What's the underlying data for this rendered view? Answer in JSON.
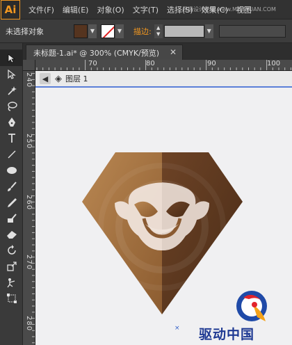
{
  "app": {
    "logo": "Ai"
  },
  "menu": {
    "items": [
      "文件(F)",
      "编辑(E)",
      "对象(O)",
      "文字(T)",
      "选择(S)",
      "效果(C)",
      "视图"
    ]
  },
  "control_bar": {
    "selection_label": "未选择对象",
    "fill_color": "#55341f",
    "stroke_label": "描边:"
  },
  "document": {
    "tab_title": "未标题-1.ai* @ 300% (CMYK/预览)",
    "close": "✕"
  },
  "ruler": {
    "horizontal": [
      "70",
      "80",
      "90",
      "100"
    ],
    "vertical": [
      "240",
      "250",
      "260",
      "270",
      "280"
    ]
  },
  "isolation": {
    "back_icon": "left-arrow-icon",
    "label": "图层 1"
  },
  "tools": [
    "selection-tool-icon",
    "direct-selection-tool-icon",
    "magic-wand-icon",
    "lasso-icon",
    "pen-tool-icon",
    "type-tool-icon",
    "line-tool-icon",
    "ellipse-tool-icon",
    "paintbrush-icon",
    "pencil-icon",
    "blob-brush-icon",
    "eraser-icon",
    "rotate-tool-icon",
    "scale-tool-icon",
    "puppet-warp-icon",
    "free-transform-icon"
  ],
  "watermark": {
    "text": "驱动中国",
    "site": "思缘设计论坛 www.MISSYUAN.COM"
  },
  "colors": {
    "light_brown": "#a57443",
    "dark_brown": "#5a3620",
    "accent": "#f29720",
    "selection_blue": "#5b7fd8"
  }
}
